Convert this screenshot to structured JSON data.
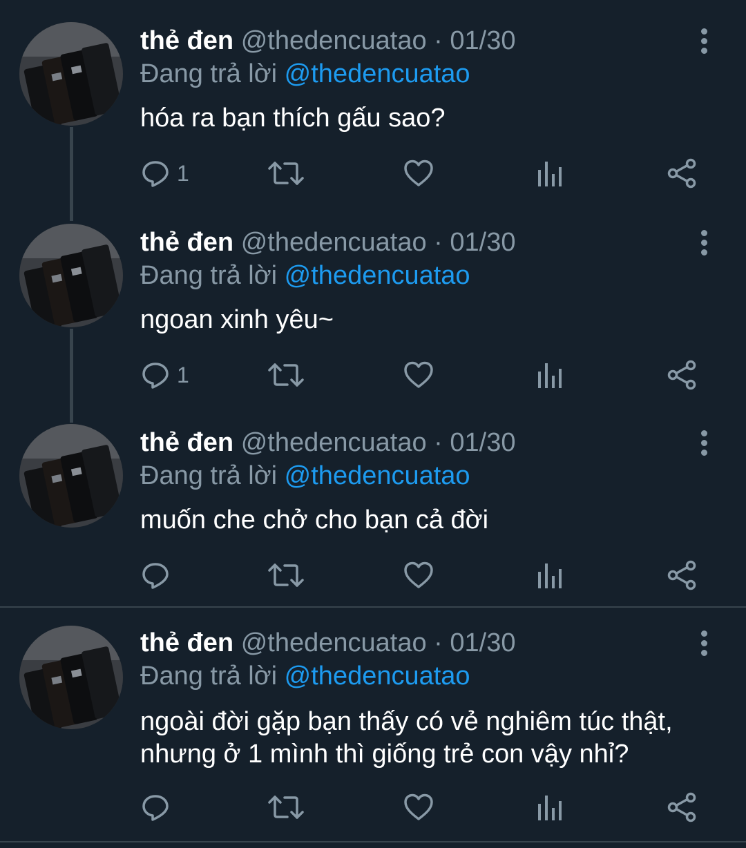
{
  "tweets": [
    {
      "name": "thẻ đen",
      "handle": "@thedencuatao",
      "separator": "·",
      "date": "01/30",
      "reply_prefix": "Đang trả lời",
      "reply_to": "@thedencuatao",
      "text": "hóa ra bạn thích gấu sao?",
      "reply_count": "1"
    },
    {
      "name": "thẻ đen",
      "handle": "@thedencuatao",
      "separator": "·",
      "date": "01/30",
      "reply_prefix": "Đang trả lời",
      "reply_to": "@thedencuatao",
      "text": "ngoan xinh yêu~",
      "reply_count": "1"
    },
    {
      "name": "thẻ đen",
      "handle": "@thedencuatao",
      "separator": "·",
      "date": "01/30",
      "reply_prefix": "Đang trả lời",
      "reply_to": "@thedencuatao",
      "text": "muốn che chở cho bạn cả đời",
      "reply_count": ""
    },
    {
      "name": "thẻ đen",
      "handle": "@thedencuatao",
      "separator": "·",
      "date": "01/30",
      "reply_prefix": "Đang trả lời",
      "reply_to": "@thedencuatao",
      "text": "ngoài đời gặp bạn thấy có vẻ nghiêm túc thật, nhưng ở 1 mình thì giống trẻ con vậy nhỉ?",
      "reply_count": ""
    }
  ],
  "icons": {
    "more": "more-vertical-icon",
    "reply": "reply-icon",
    "retweet": "retweet-icon",
    "like": "heart-icon",
    "analytics": "analytics-icon",
    "share": "share-icon"
  },
  "colors": {
    "background": "#15202b",
    "text": "#ffffff",
    "secondary": "#8899a6",
    "mention": "#1d9bf0",
    "divider": "#38444d"
  }
}
